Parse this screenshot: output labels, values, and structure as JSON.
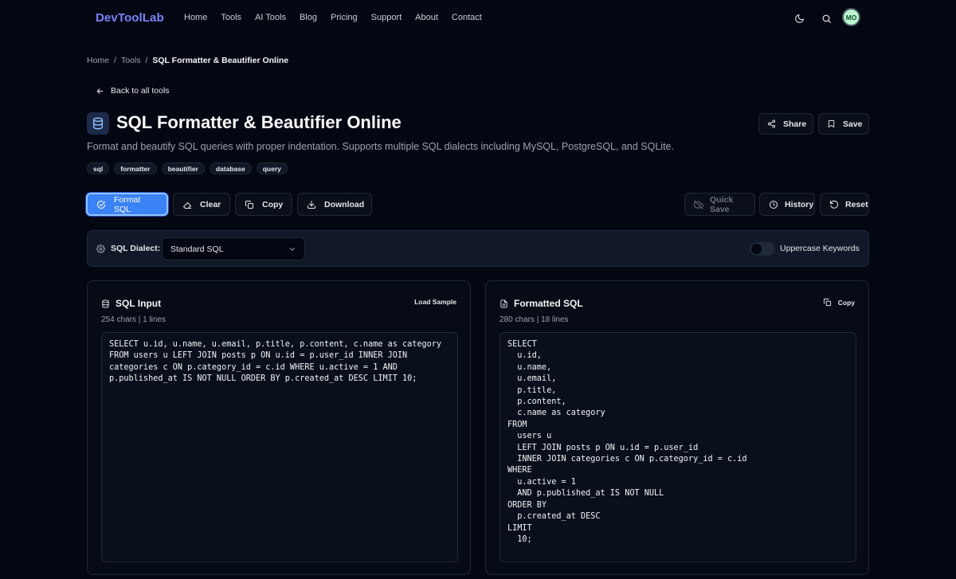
{
  "nav": {
    "logo": "DevToolLab",
    "links": [
      "Home",
      "Tools",
      "AI Tools",
      "Blog",
      "Pricing",
      "Support",
      "About",
      "Contact"
    ],
    "avatar_initials": "MO"
  },
  "breadcrumb": {
    "items": [
      "Home",
      "Tools"
    ],
    "separator": "/",
    "current": "SQL Formatter & Beautifier Online"
  },
  "back_link": "Back to all tools",
  "page": {
    "title": "SQL Formatter & Beautifier Online",
    "description": "Format and beautify SQL queries with proper indentation. Supports multiple SQL dialects including MySQL, PostgreSQL, and SQLite.",
    "tags": [
      "sql",
      "formatter",
      "beautifier",
      "database",
      "query"
    ],
    "share_label": "Share",
    "save_label": "Save"
  },
  "toolbar": {
    "format_label": "Format SQL",
    "clear_label": "Clear",
    "copy_label": "Copy",
    "download_label": "Download",
    "quick_save_label": "Quick Save",
    "history_label": "History",
    "reset_label": "Reset"
  },
  "options": {
    "dialect_label": "SQL Dialect:",
    "dialect_value": "Standard SQL",
    "uppercase_label": "Uppercase Keywords",
    "uppercase_enabled": false
  },
  "input_panel": {
    "title": "SQL Input",
    "meta": "254 chars | 1 lines",
    "action_label": "Load Sample",
    "content": "SELECT u.id, u.name, u.email, p.title, p.content, c.name as category\nFROM users u LEFT JOIN posts p ON u.id = p.user_id INNER JOIN\ncategories c ON p.category_id = c.id WHERE u.active = 1 AND\np.published_at IS NOT NULL ORDER BY p.created_at DESC LIMIT 10;"
  },
  "output_panel": {
    "title": "Formatted SQL",
    "meta": "280 chars | 18 lines",
    "action_label": "Copy",
    "content": "SELECT\n  u.id,\n  u.name,\n  u.email,\n  p.title,\n  p.content,\n  c.name as category\nFROM\n  users u\n  LEFT JOIN posts p ON u.id = p.user_id\n  INNER JOIN categories c ON p.category_id = c.id\nWHERE\n  u.active = 1\n  AND p.published_at IS NOT NULL\nORDER BY\n  p.created_at DESC\nLIMIT\n  10;"
  },
  "colors": {
    "background": "#030712",
    "accent": "#3b82f6",
    "logo": "#7c83fd",
    "avatar": "#bbf7d0"
  }
}
